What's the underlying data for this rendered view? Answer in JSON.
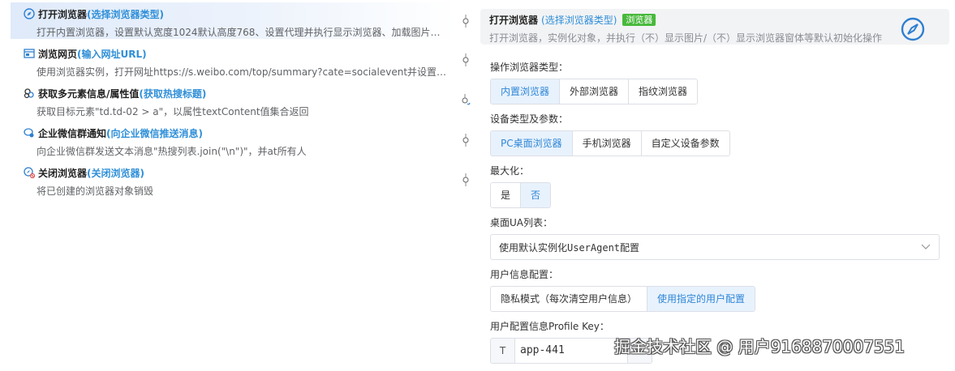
{
  "flow": {
    "steps": [
      {
        "icon": "compass-icon",
        "title": "打开浏览器",
        "sub": "(选择浏览器类型)",
        "desc": "打开内置浏览器，设置默认宽度1024默认高度768、设置代理并执行显示浏览器、加载图片、…",
        "active": true
      },
      {
        "icon": "browser-window-icon",
        "title": "浏览网页",
        "sub": "(输入网址URL)",
        "desc": "使用浏览器实例，打开网址https://s.weibo.com/top/summary?cate=socialevent并设置UserAgent",
        "active": false
      },
      {
        "icon": "elements-icon",
        "title": "获取多元素信息/属性值",
        "sub": "(获取热搜标题)",
        "desc": "获取目标元素\"td.td-02 > a\"，以属性textContent值集合返回",
        "active": false
      },
      {
        "icon": "wecom-icon",
        "title": "企业微信群通知",
        "sub": "(向企业微信推送消息)",
        "desc": "向企业微信群发送文本消息\"热搜列表.join(\"\\n\")\"，并at所有人",
        "active": false
      },
      {
        "icon": "close-browser-icon",
        "title": "关闭浏览器",
        "sub": "(关闭浏览器)",
        "desc": "将已创建的浏览器对象销毁",
        "active": false
      }
    ]
  },
  "panel": {
    "card": {
      "title": "打开浏览器",
      "sub": "(选择浏览器类型)",
      "tag": "浏览器",
      "desc": "打开浏览器，实例化对象，并执行（不）显示图片/（不）显示浏览器窗体等默认初始化操作"
    },
    "browser_type": {
      "label": "操作浏览器类型：",
      "options": [
        "内置浏览器",
        "外部浏览器",
        "指纹浏览器"
      ],
      "selected": "内置浏览器"
    },
    "device": {
      "label": "设备类型及参数：",
      "options": [
        "PC桌面浏览器",
        "手机浏览器",
        "自定义设备参数"
      ],
      "selected": "PC桌面浏览器"
    },
    "maximize": {
      "label": "最大化：",
      "options": [
        "是",
        "否"
      ],
      "selected": "否"
    },
    "ua": {
      "label": "桌面UA列表：",
      "value": "使用默认实例化UserAgent配置"
    },
    "user_config": {
      "label": "用户信息配置：",
      "options": [
        "隐私模式（每次清空用户信息）",
        "使用指定的用户配置"
      ],
      "selected": "使用指定的用户配置"
    },
    "profile": {
      "label": "用户配置信息Profile Key：",
      "prefix": "T",
      "value": "app-441"
    }
  },
  "watermark": "掘金技术社区 @ 用户9168870007551",
  "colors": {
    "accent": "#2f8fd8",
    "tag_green": "#47b93b",
    "selected_bg": "#e8f2fd"
  }
}
